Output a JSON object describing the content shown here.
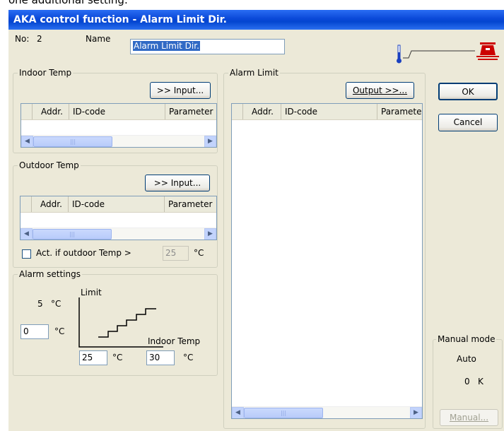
{
  "caption": "one additional setting.",
  "window": {
    "title": "AKA control function - Alarm Limit Dir."
  },
  "header": {
    "no_label": "No:",
    "no_value": "2",
    "name_label": "Name",
    "name_value": "Alarm Limit Dir."
  },
  "indoor": {
    "title": "Indoor Temp",
    "input_button": ">> Input...",
    "columns": [
      "Addr.",
      "ID-code",
      "Parameter"
    ]
  },
  "outdoor": {
    "title": "Outdoor Temp",
    "input_button": ">> Input...",
    "columns": [
      "Addr.",
      "ID-code",
      "Parameter"
    ],
    "act_label": "Act. if outdoor Temp >",
    "act_value": "25",
    "act_unit": "°C"
  },
  "alarm_settings": {
    "title": "Alarm settings",
    "value_top": "5",
    "unit_top": "°C",
    "input_left": "0",
    "unit_left": "°C",
    "limit_label": "Limit",
    "indoor_label": "Indoor Temp",
    "input_a": "25",
    "unit_a": "°C",
    "input_b": "30",
    "unit_b": "°C"
  },
  "alarm_limit": {
    "title": "Alarm Limit",
    "output_button": "Output >>...",
    "columns": [
      "Addr.",
      "ID-code",
      "Paramete"
    ]
  },
  "buttons": {
    "ok": "OK",
    "cancel": "Cancel",
    "manual": "Manual..."
  },
  "manual_mode": {
    "title": "Manual mode",
    "mode": "Auto",
    "value": "0",
    "unit": "K"
  },
  "colors": {
    "titlebar": "#0a48d8",
    "dialog": "#ece9d8",
    "thermometer": "#1a40c0",
    "bell": "#cc0000"
  }
}
